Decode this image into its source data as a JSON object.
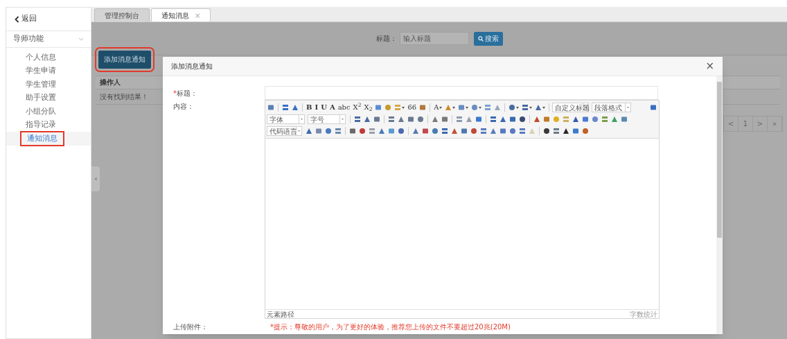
{
  "sidebar": {
    "back": "返回",
    "section": {
      "label": "导师功能",
      "expanded": true
    },
    "items": [
      {
        "label": "个人信息",
        "selected": false
      },
      {
        "label": "学生申请",
        "selected": false
      },
      {
        "label": "学生管理",
        "selected": false
      },
      {
        "label": "助手设置",
        "selected": false
      },
      {
        "label": "小组分队",
        "selected": false
      },
      {
        "label": "指导记录",
        "selected": false
      },
      {
        "label": "通知消息",
        "selected": true
      }
    ]
  },
  "tabs": [
    {
      "label": "管理控制台",
      "selected": false
    },
    {
      "label": "通知消息",
      "selected": true,
      "close": "×"
    }
  ],
  "search": {
    "label": "标题：",
    "placeholder": "输入标题",
    "button": "搜索"
  },
  "add_button": "添加消息通知",
  "table": {
    "columns": [
      "操作人"
    ],
    "empty_message": "没有找到结果！"
  },
  "pagination": [
    "<",
    "1",
    ">",
    "»"
  ],
  "modal": {
    "title": "添加消息通知",
    "close": "×",
    "required_mark": "*",
    "title_label": "标题：",
    "content_label": "内容：",
    "editor": {
      "toolbar": [
        [
          {
            "kind": "tool",
            "color": "#5b7fb5"
          },
          {
            "kind": "sep"
          },
          {
            "kind": "tool",
            "color": "#3b6fc4"
          },
          {
            "kind": "tool",
            "color": "#3b6fc4"
          },
          {
            "kind": "sep"
          },
          {
            "kind": "glyph",
            "text": "B"
          },
          {
            "kind": "glyph",
            "text": "I"
          },
          {
            "kind": "glyph",
            "text": "U"
          },
          {
            "kind": "glyph",
            "text": "A"
          },
          {
            "kind": "glyph",
            "text": "abc"
          },
          {
            "kind": "glyph",
            "text": "X$^{2}$"
          },
          {
            "kind": "glyph",
            "text": "X$_{2}$"
          },
          {
            "kind": "tool",
            "color": "#5a8fd6"
          },
          {
            "kind": "tool",
            "color": "#c89a2e"
          },
          {
            "kind": "tool",
            "color": "#d6a84a",
            "caret": true
          },
          {
            "kind": "glyph",
            "text": "66"
          },
          {
            "kind": "tool",
            "color": "#b07a3a"
          },
          {
            "kind": "sep"
          },
          {
            "kind": "glyph",
            "text": "A",
            "caret": true
          },
          {
            "kind": "tool",
            "color": "#d08a2a",
            "caret": true
          },
          {
            "kind": "tool",
            "color": "#6b8cc0",
            "caret": true
          },
          {
            "kind": "tool",
            "color": "#6b8cc0",
            "caret": true
          },
          {
            "kind": "tool",
            "color": "#7aa0d0"
          },
          {
            "kind": "tool",
            "color": "#9aa8b8"
          },
          {
            "kind": "sep"
          },
          {
            "kind": "tool",
            "color": "#4a6aa0",
            "caret": true
          },
          {
            "kind": "tool",
            "color": "#4a6aa0",
            "caret": true
          },
          {
            "kind": "tool",
            "color": "#4a6aa0",
            "caret": true
          },
          {
            "kind": "sep"
          },
          {
            "kind": "select",
            "label": "自定义标题"
          },
          {
            "kind": "select",
            "label": "段落格式"
          },
          {
            "kind": "spacer"
          },
          {
            "kind": "tool",
            "color": "#3a6ec0"
          }
        ],
        [
          {
            "kind": "select",
            "label": "字体"
          },
          {
            "kind": "select",
            "label": "字号"
          },
          {
            "kind": "sep"
          },
          {
            "kind": "tool",
            "color": "#4a6aa0"
          },
          {
            "kind": "tool",
            "color": "#4a6aa0"
          },
          {
            "kind": "tool",
            "color": "#6a7a90"
          },
          {
            "kind": "sep"
          },
          {
            "kind": "tool",
            "color": "#6a7a90"
          },
          {
            "kind": "tool",
            "color": "#6a7a90"
          },
          {
            "kind": "tool",
            "color": "#6a7a90"
          },
          {
            "kind": "tool",
            "color": "#6a7a90"
          },
          {
            "kind": "sep"
          },
          {
            "kind": "tool",
            "color": "#7a7a7a"
          },
          {
            "kind": "tool",
            "color": "#7a7a7a"
          },
          {
            "kind": "sep"
          },
          {
            "kind": "tool",
            "color": "#8a9ab0"
          },
          {
            "kind": "tool",
            "color": "#9aa0a8"
          },
          {
            "kind": "tool",
            "color": "#3a7ad0"
          },
          {
            "kind": "sep"
          },
          {
            "kind": "tool",
            "color": "#3a6ab0"
          },
          {
            "kind": "tool",
            "color": "#3a6ab0"
          },
          {
            "kind": "tool",
            "color": "#3a6ab0"
          },
          {
            "kind": "tool",
            "color": "#3a4a70"
          },
          {
            "kind": "sep"
          },
          {
            "kind": "tool",
            "color": "#c04a2a"
          },
          {
            "kind": "tool",
            "color": "#c07a2a"
          },
          {
            "kind": "tool",
            "color": "#e0b020"
          },
          {
            "kind": "tool",
            "color": "#d0b060"
          },
          {
            "kind": "tool",
            "color": "#3a5ab0"
          },
          {
            "kind": "tool",
            "color": "#4a7ad0"
          },
          {
            "kind": "tool",
            "color": "#6a8ad0"
          },
          {
            "kind": "tool",
            "color": "#7aa04a"
          },
          {
            "kind": "tool",
            "color": "#3aa06a"
          },
          {
            "kind": "tool",
            "color": "#5a8ab0"
          }
        ],
        [
          {
            "kind": "select",
            "label": "代码语言"
          },
          {
            "kind": "tool",
            "color": "#3a6ab0"
          },
          {
            "kind": "tool",
            "color": "#7a8ab0"
          },
          {
            "kind": "tool",
            "color": "#4a7ac0"
          },
          {
            "kind": "tool",
            "color": "#6a8ab0"
          },
          {
            "kind": "sep"
          },
          {
            "kind": "tool",
            "color": "#6a6a6a"
          },
          {
            "kind": "tool",
            "color": "#c03a3a"
          },
          {
            "kind": "tool",
            "color": "#9aa0a8"
          },
          {
            "kind": "tool",
            "color": "#4a7ac0"
          },
          {
            "kind": "tool",
            "color": "#5a9ad0"
          },
          {
            "kind": "tool",
            "color": "#4a6ab0"
          },
          {
            "kind": "sep"
          },
          {
            "kind": "tool",
            "color": "#5a7ab0"
          },
          {
            "kind": "tool",
            "color": "#c04a4a"
          },
          {
            "kind": "tool",
            "color": "#4a7ab0"
          },
          {
            "kind": "tool",
            "color": "#3a6ab0"
          },
          {
            "kind": "tool",
            "color": "#c0503a"
          },
          {
            "kind": "tool",
            "color": "#4a7ab0"
          },
          {
            "kind": "tool",
            "color": "#c04a3a"
          },
          {
            "kind": "tool",
            "color": "#5a7ac0"
          },
          {
            "kind": "tool",
            "color": "#5a7ac0"
          },
          {
            "kind": "tool",
            "color": "#5a7ac0"
          },
          {
            "kind": "tool",
            "color": "#5a7ac0"
          },
          {
            "kind": "tool",
            "color": "#5a7ac0"
          },
          {
            "kind": "tool",
            "color": "#d8d0b0"
          },
          {
            "kind": "sep"
          },
          {
            "kind": "tool",
            "color": "#3a3a3a"
          },
          {
            "kind": "tool",
            "color": "#6a7a8a"
          },
          {
            "kind": "tool",
            "color": "#2a2a2a"
          },
          {
            "kind": "tool",
            "color": "#3a7ad0"
          },
          {
            "kind": "tool",
            "color": "#c0602a"
          }
        ]
      ],
      "path_label": "元素路径",
      "word_count": "字数统计"
    },
    "attachment_label": "上传附件：",
    "attachment_hint": "*提示：尊敬的用户，为了更好的体验，推荐您上传的文件不要超过20兆(20M)"
  }
}
